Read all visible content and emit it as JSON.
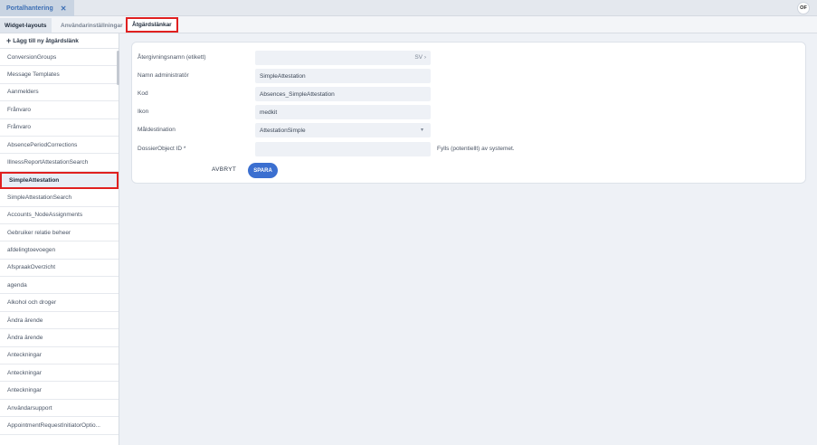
{
  "app_tab": {
    "label": "Portalhantering",
    "close": "✕"
  },
  "user": {
    "initials": "OF"
  },
  "subtabs": [
    {
      "label": "Widget-layouts"
    },
    {
      "label": "Användarinställningar"
    },
    {
      "label": "Åtgärdslänkar"
    }
  ],
  "sidebar": {
    "add_label": "Lägg till ny åtgärdslänk",
    "items": [
      "ConversionGroups",
      "Message Templates",
      "Aanmelders",
      "Frånvaro",
      "Frånvaro",
      "AbsencePeriodCorrections",
      "IllnessReportAttestationSearch",
      "SimpleAttestation",
      "SimpleAttestationSearch",
      "Accounts_NodeAssignments",
      "Gebruiker relatie beheer",
      "afdelingtoevoegen",
      "AfspraakOverzicht",
      "agenda",
      "Alkohol och droger",
      "Ändra ärende",
      "Ändra ärende",
      "Anteckningar",
      "Anteckningar",
      "Anteckningar",
      "Användarsupport",
      "AppointmentRequestInitiatorOptio..."
    ]
  },
  "form": {
    "fields": [
      {
        "label": "Återgivningsnamn (etikett)",
        "value": "",
        "suffix": "SV  ›"
      },
      {
        "label": "Namn administratör",
        "value": "SimpleAttestation"
      },
      {
        "label": "Kod",
        "value": "Absences_SimpleAttestation"
      },
      {
        "label": "Ikon",
        "value": "medkit"
      },
      {
        "label": "Måldestination",
        "value": "AttestationSimple",
        "caret": "▾"
      },
      {
        "label": "DossierObject ID *",
        "value": "",
        "hint": "Fylls (potentiellt) av systemet."
      }
    ],
    "cancel_label": "AVBRYT",
    "save_label": "SPARA"
  },
  "colors": {
    "accent": "#3b6fd0",
    "highlight": "#e02020"
  }
}
